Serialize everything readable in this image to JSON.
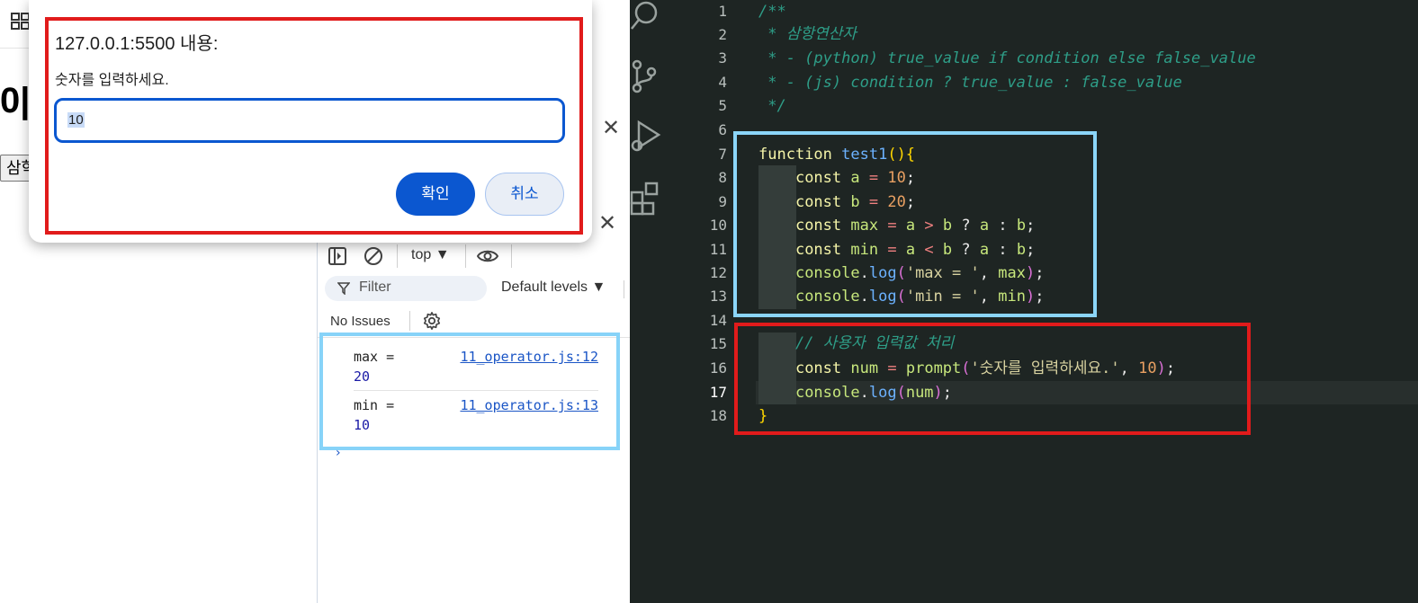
{
  "browser": {
    "heading": "0|",
    "button_label": "삼학"
  },
  "dialog": {
    "title": "127.0.0.1:5500 내용:",
    "message": "숫자를 입력하세요.",
    "input_value": "10",
    "ok_label": "확인",
    "cancel_label": "취소",
    "ok_color": "#0b57d0"
  },
  "devtools": {
    "close_glyph": "✕",
    "context": "top ▼",
    "filter_placeholder": "Filter",
    "levels": "Default levels ▼",
    "issues": "No Issues",
    "prompt_chevron": "›",
    "logs": [
      {
        "message": "max =",
        "value": "20",
        "source": "11_operator.js:12"
      },
      {
        "message": "min =",
        "value": "10",
        "source": "11_operator.js:13"
      }
    ]
  },
  "editor": {
    "active_line": "17",
    "line_numbers": [
      "1",
      "2",
      "3",
      "4",
      "5",
      "6",
      "7",
      "8",
      "9",
      "10",
      "11",
      "12",
      "13",
      "14",
      "15",
      "16",
      "17",
      "18"
    ],
    "activity_icons": [
      "search-icon",
      "source-control-icon",
      "run-debug-icon",
      "extensions-icon"
    ]
  },
  "highlight_colors": {
    "red": "#e11b1b",
    "blue": "#87d3f8"
  }
}
